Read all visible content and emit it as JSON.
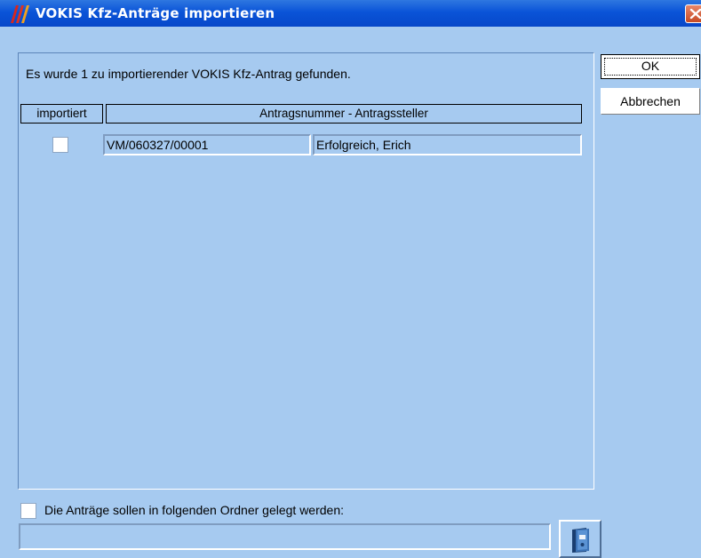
{
  "window": {
    "title": "VOKIS Kfz-Anträge importieren"
  },
  "info": {
    "text": "Es wurde  1 zu importierender VOKIS Kfz-Antrag gefunden."
  },
  "table": {
    "headers": [
      "importiert",
      "Antragsnummer  -  Antragssteller"
    ],
    "rows": [
      {
        "imported": false,
        "number": "VM/060327/00001",
        "applicant": "Erfolgreich, Erich"
      }
    ]
  },
  "buttons": {
    "ok": "OK",
    "cancel": "Abbrechen"
  },
  "folder": {
    "checkbox_checked": false,
    "label": "Die Anträge sollen in folgenden Ordner gelegt werden:",
    "path_value": "",
    "browse_icon": "folder-binder-icon"
  },
  "colors": {
    "window_background": "#a6caf0",
    "titlebar": "#0a54d8",
    "close_button": "#d2603a"
  }
}
